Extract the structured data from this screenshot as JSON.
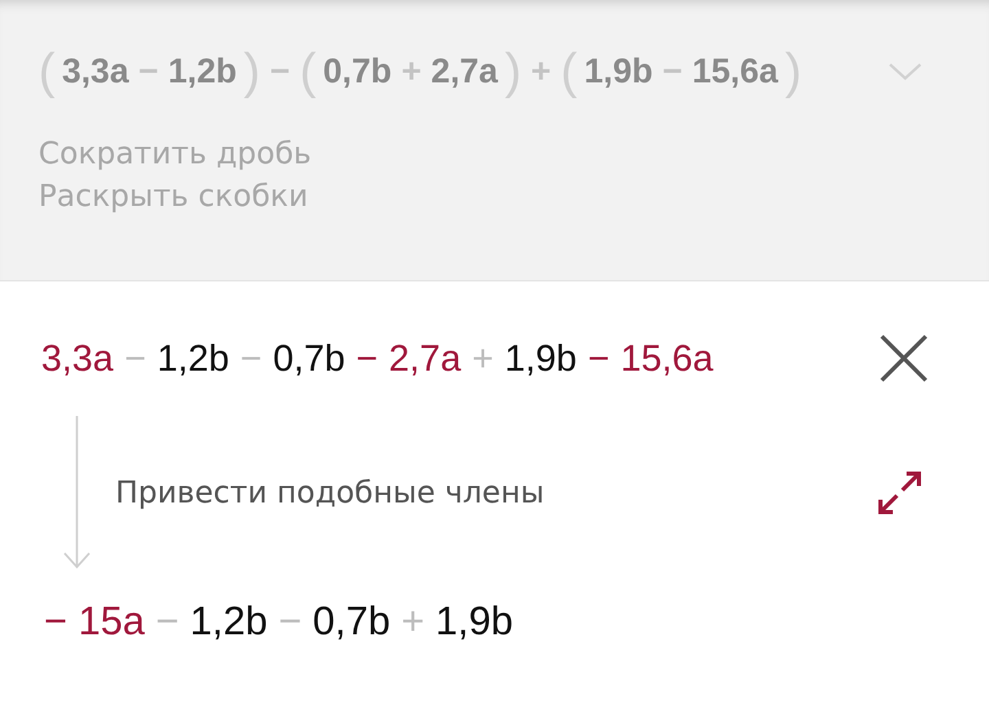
{
  "problem": {
    "expression": [
      {
        "text": "(",
        "kind": "paren"
      },
      {
        "text": "3,3a",
        "kind": "term"
      },
      {
        "text": "−",
        "kind": "op"
      },
      {
        "text": "1,2b",
        "kind": "term"
      },
      {
        "text": ")",
        "kind": "paren"
      },
      {
        "text": "−",
        "kind": "op"
      },
      {
        "text": "(",
        "kind": "paren"
      },
      {
        "text": "0,7b",
        "kind": "term"
      },
      {
        "text": "+",
        "kind": "op"
      },
      {
        "text": "2,7a",
        "kind": "term"
      },
      {
        "text": ")",
        "kind": "paren"
      },
      {
        "text": "+",
        "kind": "op"
      },
      {
        "text": "(",
        "kind": "paren"
      },
      {
        "text": "1,9b",
        "kind": "term"
      },
      {
        "text": "−",
        "kind": "op"
      },
      {
        "text": "15,6a",
        "kind": "term"
      },
      {
        "text": ")",
        "kind": "paren"
      }
    ],
    "actions": [
      "Сократить дробь",
      "Раскрыть скобки"
    ]
  },
  "step": {
    "input": [
      {
        "text": "3,3a",
        "kind": "term",
        "highlighted": true
      },
      {
        "text": "−",
        "kind": "op",
        "highlighted": false
      },
      {
        "text": "1,2b",
        "kind": "term",
        "highlighted": false
      },
      {
        "text": "−",
        "kind": "op",
        "highlighted": false
      },
      {
        "text": "0,7b",
        "kind": "term",
        "highlighted": false
      },
      {
        "text": "−",
        "kind": "op",
        "highlighted": true
      },
      {
        "text": "2,7a",
        "kind": "term",
        "highlighted": true
      },
      {
        "text": "+",
        "kind": "op",
        "highlighted": false
      },
      {
        "text": "1,9b",
        "kind": "term",
        "highlighted": false
      },
      {
        "text": "−",
        "kind": "op",
        "highlighted": true
      },
      {
        "text": "15,6a",
        "kind": "term",
        "highlighted": true
      }
    ],
    "rule": "Привести подобные члены",
    "output": [
      {
        "text": "−",
        "kind": "op",
        "highlighted": true
      },
      {
        "text": "15a",
        "kind": "term",
        "highlighted": true
      },
      {
        "text": "−",
        "kind": "op",
        "highlighted": false
      },
      {
        "text": "1,2b",
        "kind": "term",
        "highlighted": false
      },
      {
        "text": "−",
        "kind": "op",
        "highlighted": false
      },
      {
        "text": "0,7b",
        "kind": "term",
        "highlighted": false
      },
      {
        "text": "+",
        "kind": "op",
        "highlighted": false
      },
      {
        "text": "1,9b",
        "kind": "term",
        "highlighted": false
      }
    ]
  }
}
